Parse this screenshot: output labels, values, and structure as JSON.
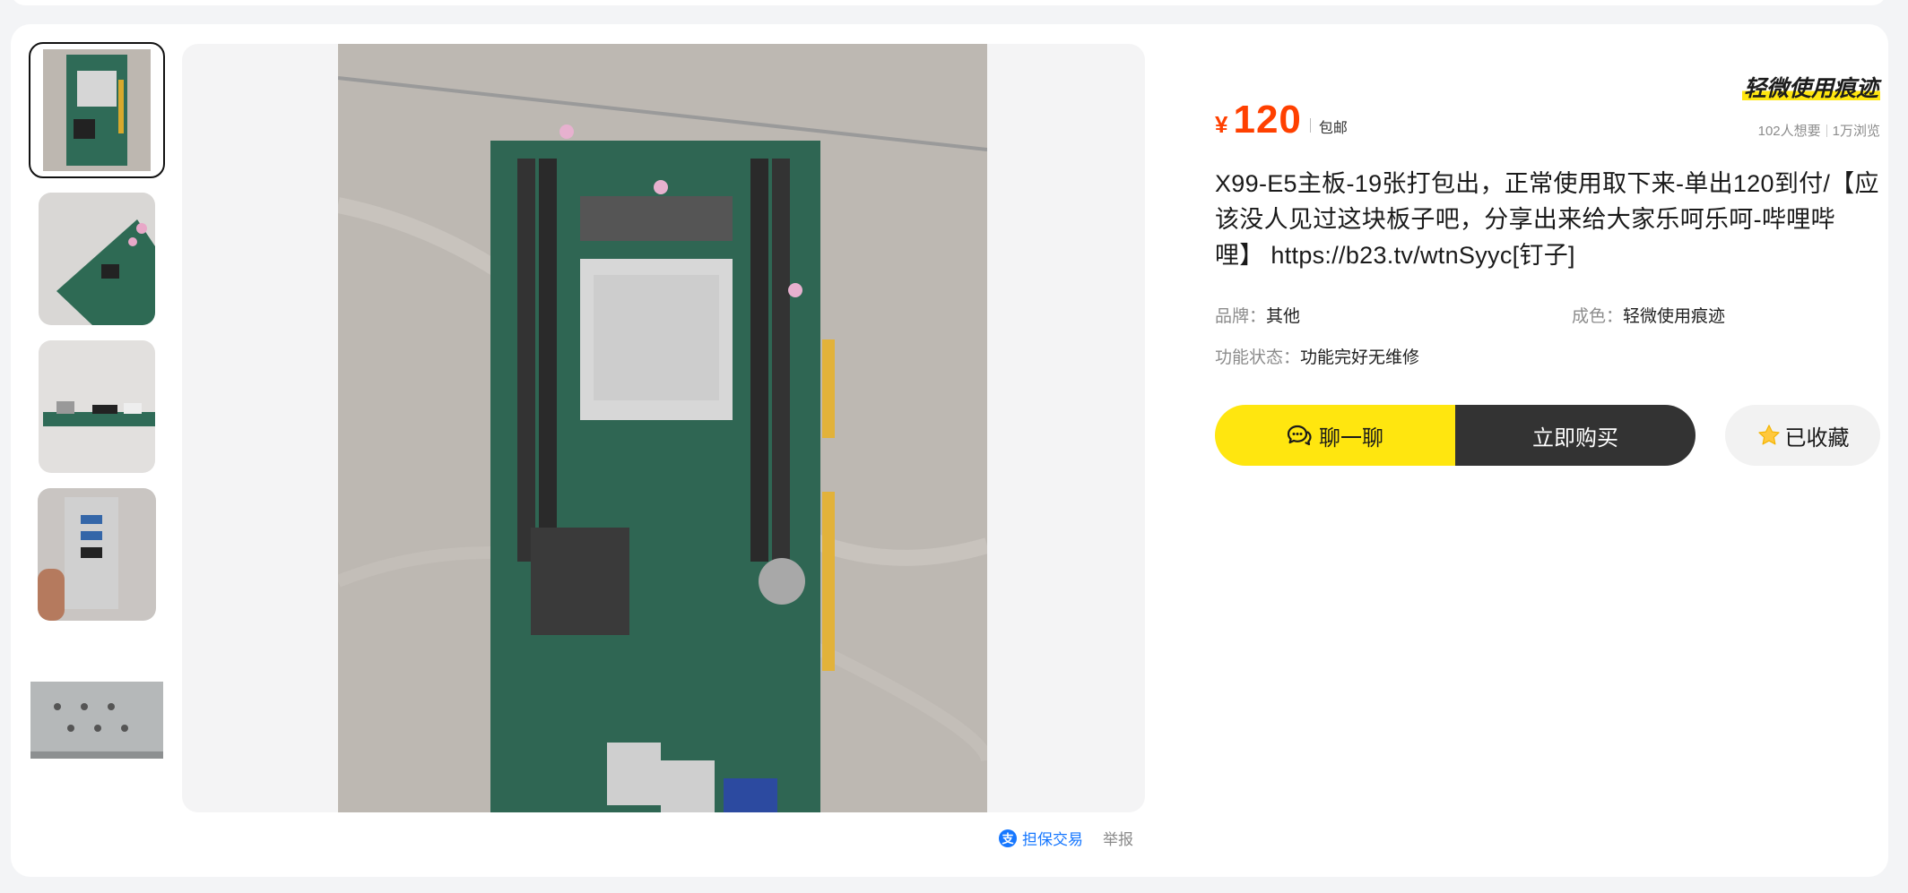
{
  "gallery": {
    "thumbnails": [
      {
        "alt": "主板正面",
        "active": true
      },
      {
        "alt": "主板侧面",
        "active": false
      },
      {
        "alt": "主板接口",
        "active": false
      },
      {
        "alt": "手持机箱背板",
        "active": false
      },
      {
        "alt": "金属底板",
        "active": false
      }
    ]
  },
  "below_image": {
    "guarantee_label": "担保交易",
    "report_label": "举报"
  },
  "product": {
    "condition_tag": "轻微使用痕迹",
    "price_symbol": "¥",
    "price": "120",
    "shipping": "包邮",
    "wants": "102人想要",
    "views": "1万浏览",
    "title": "X99-E5主板-19张打包出，正常使用取下来-单出120到付/【应该没人见过这块板子吧，分享出来给大家乐呵乐呵-哔哩哔哩】 https://b23.tv/wtnSyyc[钉子]",
    "attributes": {
      "brand_key": "品牌：",
      "brand_value": "其他",
      "condition_key": "成色：",
      "condition_value": "轻微使用痕迹",
      "function_key": "功能状态：",
      "function_value": "功能完好无维修"
    }
  },
  "actions": {
    "chat_label": "聊一聊",
    "buy_label": "立即购买",
    "fav_label": "已收藏"
  },
  "colors": {
    "price": "#ff4000",
    "chat_button": "#ffe60f",
    "buy_button": "#333333",
    "guarantee": "#1677ff",
    "star": "#ffc83d"
  },
  "icons": {
    "chat": "chat-bubble-icon",
    "favorite": "star-icon",
    "guarantee": "alipay-icon"
  }
}
